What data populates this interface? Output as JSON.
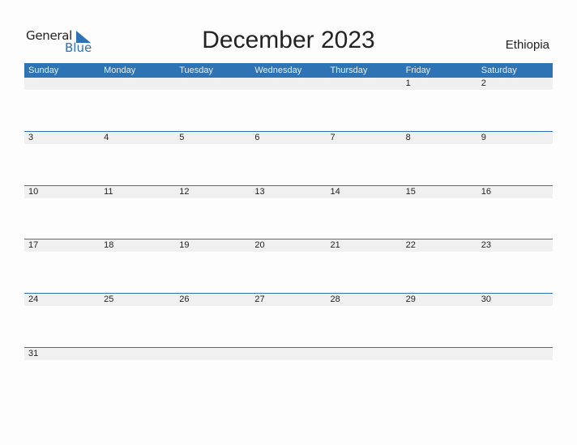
{
  "logo": {
    "line1": "General",
    "line2": "Blue"
  },
  "title": "December 2023",
  "country": "Ethiopia",
  "days": [
    "Sunday",
    "Monday",
    "Tuesday",
    "Wednesday",
    "Thursday",
    "Friday",
    "Saturday"
  ],
  "weeks": [
    [
      "",
      "",
      "",
      "",
      "",
      "1",
      "2"
    ],
    [
      "3",
      "4",
      "5",
      "6",
      "7",
      "8",
      "9"
    ],
    [
      "10",
      "11",
      "12",
      "13",
      "14",
      "15",
      "16"
    ],
    [
      "17",
      "18",
      "19",
      "20",
      "21",
      "22",
      "23"
    ],
    [
      "24",
      "25",
      "26",
      "27",
      "28",
      "29",
      "30"
    ],
    [
      "31",
      "",
      "",
      "",
      "",
      "",
      ""
    ]
  ],
  "colors": {
    "accent": "#2e74b5",
    "strip": "#f0f0f0"
  }
}
